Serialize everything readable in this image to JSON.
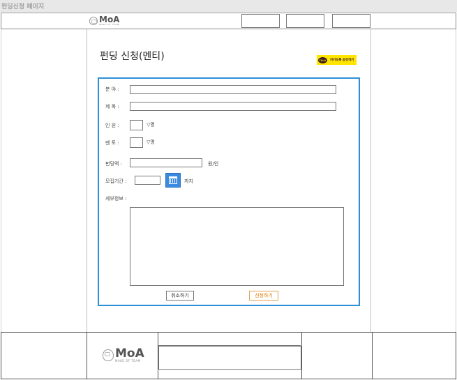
{
  "page_label": "펀딩신청 페이지",
  "header": {
    "logo_word": "MoA",
    "logo_tagline": "MAKE OF TEAM",
    "nav": [
      "",
      "",
      ""
    ]
  },
  "title": "펀딩 신청(멘티)",
  "kakao_button": {
    "label": "카카오톡 공유하기",
    "badge": "TALK"
  },
  "form": {
    "field_label": "분 야 :",
    "title_label": "제 목 :",
    "people_label": "인 원 :",
    "people_unit": "▽명",
    "mentor_label": "멘 토 :",
    "mentor_unit": "▽명",
    "amount_label": "펀딩액 :",
    "amount_unit": "원/인",
    "period_label": "모집기간 :",
    "period_unit": "까지",
    "detail_label": "세부정보 :"
  },
  "buttons": {
    "cancel": "취소하기",
    "submit": "신청하기"
  },
  "footer": {
    "logo_word": "MoA",
    "logo_tagline": "MAKE OF TEAM"
  },
  "colors": {
    "accent": "#2d8fd6",
    "kakao": "#ffe600",
    "submit_text": "#e07b00"
  }
}
